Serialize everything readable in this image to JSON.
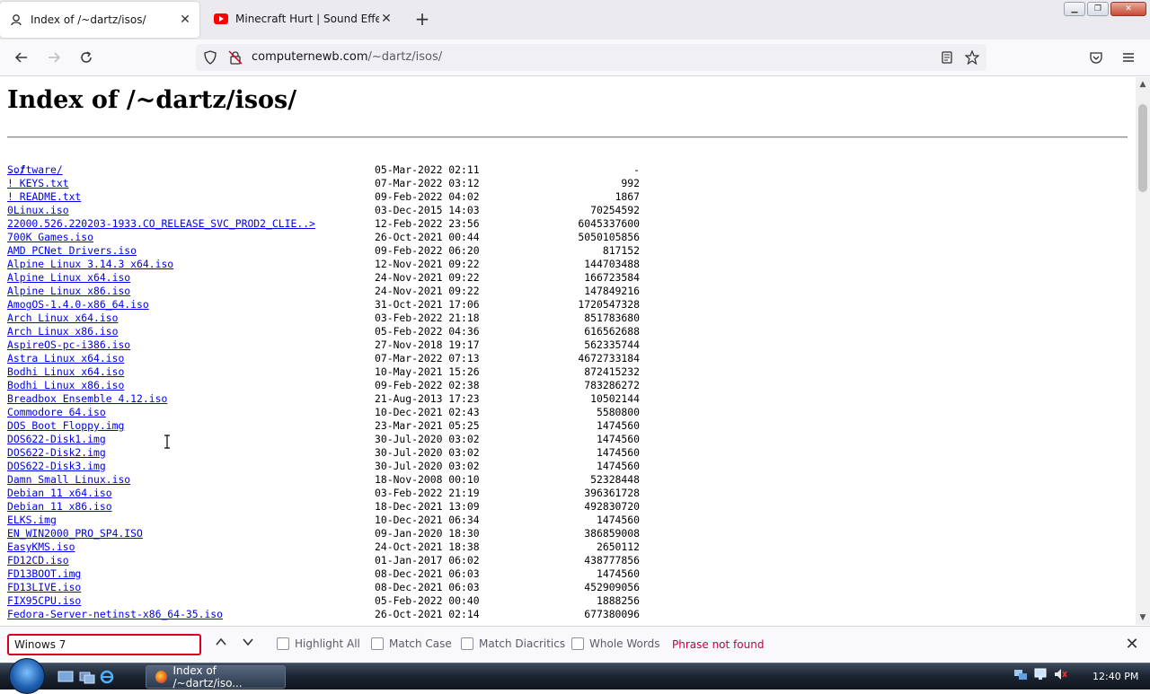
{
  "tabs": [
    {
      "title": "Index of /~dartz/isos/",
      "icon": "page-icon"
    },
    {
      "title": "Minecraft Hurt | Sound Effect -",
      "icon": "youtube-icon"
    }
  ],
  "newtab_label": "+",
  "url": {
    "host": "computernewb.com",
    "path": "/~dartz/isos/"
  },
  "page": {
    "title": "Index of /~dartz/isos/",
    "parent": "../",
    "entries": [
      {
        "name": "Software/",
        "date": "05-Mar-2022 02:11",
        "size": "-"
      },
      {
        "name": "! KEYS.txt",
        "date": "07-Mar-2022 03:12",
        "size": "992"
      },
      {
        "name": "! README.txt",
        "date": "09-Feb-2022 04:02",
        "size": "1867"
      },
      {
        "name": "0Linux.iso",
        "date": "03-Dec-2015 14:03",
        "size": "70254592"
      },
      {
        "name": "22000.526.220203-1933.CO_RELEASE_SVC_PROD2_CLIE..>",
        "date": "12-Feb-2022 23:56",
        "size": "6045337600"
      },
      {
        "name": "700K Games.iso",
        "date": "26-Oct-2021 00:44",
        "size": "5050105856"
      },
      {
        "name": "AMD PCNet Drivers.iso",
        "date": "09-Feb-2022 06:20",
        "size": "817152"
      },
      {
        "name": "Alpine Linux 3.14.3 x64.iso",
        "date": "12-Nov-2021 09:22",
        "size": "144703488"
      },
      {
        "name": "Alpine Linux x64.iso",
        "date": "24-Nov-2021 09:22",
        "size": "166723584"
      },
      {
        "name": "Alpine Linux x86.iso",
        "date": "24-Nov-2021 09:22",
        "size": "147849216"
      },
      {
        "name": "AmogOS-1.4.0-x86_64.iso",
        "date": "31-Oct-2021 17:06",
        "size": "1720547328"
      },
      {
        "name": "Arch Linux x64.iso",
        "date": "03-Feb-2022 21:18",
        "size": "851783680"
      },
      {
        "name": "Arch Linux x86.iso",
        "date": "05-Feb-2022 04:36",
        "size": "616562688"
      },
      {
        "name": "AspireOS-pc-i386.iso",
        "date": "27-Nov-2018 19:17",
        "size": "562335744"
      },
      {
        "name": "Astra Linux x64.iso",
        "date": "07-Mar-2022 07:13",
        "size": "4672733184"
      },
      {
        "name": "Bodhi Linux x64.iso",
        "date": "10-May-2021 15:26",
        "size": "872415232"
      },
      {
        "name": "Bodhi Linux x86.iso",
        "date": "09-Feb-2022 02:38",
        "size": "783286272"
      },
      {
        "name": "Breadbox Ensemble 4.12.iso",
        "date": "21-Aug-2013 17:23",
        "size": "10502144"
      },
      {
        "name": "Commodore 64.iso",
        "date": "10-Dec-2021 02:43",
        "size": "5580800"
      },
      {
        "name": "DOS Boot Floppy.img",
        "date": "23-Mar-2021 05:25",
        "size": "1474560"
      },
      {
        "name": "DOS622-Disk1.img",
        "date": "30-Jul-2020 03:02",
        "size": "1474560"
      },
      {
        "name": "DOS622-Disk2.img",
        "date": "30-Jul-2020 03:02",
        "size": "1474560"
      },
      {
        "name": "DOS622-Disk3.img",
        "date": "30-Jul-2020 03:02",
        "size": "1474560"
      },
      {
        "name": "Damn Small Linux.iso",
        "date": "18-Nov-2008 00:10",
        "size": "52328448"
      },
      {
        "name": "Debian 11 x64.iso",
        "date": "03-Feb-2022 21:19",
        "size": "396361728"
      },
      {
        "name": "Debian 11 x86.iso",
        "date": "18-Dec-2021 13:09",
        "size": "492830720"
      },
      {
        "name": "ELKS.img",
        "date": "10-Dec-2021 06:34",
        "size": "1474560"
      },
      {
        "name": "EN_WIN2000_PRO_SP4.ISO",
        "date": "09-Jan-2020 18:30",
        "size": "386859008"
      },
      {
        "name": "EasyKMS.iso",
        "date": "24-Oct-2021 18:38",
        "size": "2650112"
      },
      {
        "name": "FD12CD.iso",
        "date": "01-Jan-2017 06:02",
        "size": "438777856"
      },
      {
        "name": "FD13BOOT.img",
        "date": "08-Dec-2021 06:03",
        "size": "1474560"
      },
      {
        "name": "FD13LIVE.iso",
        "date": "08-Dec-2021 06:03",
        "size": "452909056"
      },
      {
        "name": "FIX95CPU.iso",
        "date": "05-Feb-2022 00:40",
        "size": "1888256"
      },
      {
        "name": "Fedora-Server-netinst-x86_64-35.iso",
        "date": "26-Oct-2021 02:14",
        "size": "677380096"
      }
    ]
  },
  "findbar": {
    "query": "Winows 7",
    "highlight_all": "Highlight All",
    "match_case": "Match Case",
    "match_diacritics": "Match Diacritics",
    "whole_words": "Whole Words",
    "status": "Phrase not found"
  },
  "taskbar": {
    "task_label": "Index of /~dartz/iso...",
    "clock": "12:40 PM"
  },
  "colors": {
    "link": "#0000ee",
    "find_error": "#c50042"
  }
}
